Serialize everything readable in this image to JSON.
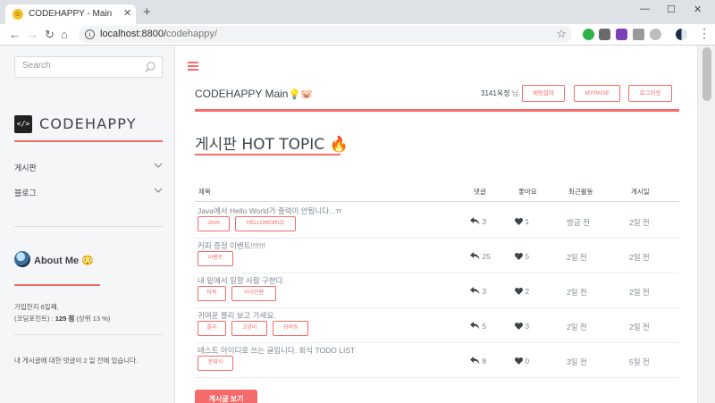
{
  "browser": {
    "tab_title": "CODEHAPPY - Main",
    "tab_favicon": "smiley-emoji",
    "url_host": "localhost:8800/",
    "url_path": "codehappy/",
    "colors": {
      "tabbar": "#dee1e6",
      "omnibox": "#f1f3f4"
    }
  },
  "sidebar": {
    "search_placeholder": "Search",
    "logo_icon_text": "</>",
    "logo_text": "CODEHAPPY",
    "menu": [
      {
        "label": "게시판"
      },
      {
        "label": "블로그"
      }
    ],
    "about_title": "About Me",
    "about_emoji": "😳",
    "join_text": "가입한지 6일째,",
    "points_prefix": "(코딩포인트) : ",
    "points_value": "125 점",
    "points_suffix": " (상위 13 %)",
    "notice": "내 게시글에 대한 댓글이 2 일 전에 있습니다."
  },
  "header": {
    "title": "CODEHAPPY Main",
    "title_emoji": "💡🐷",
    "user_name": "3141옥정",
    "user_suffix": " 님,",
    "buttons": [
      {
        "label": "채팅참여"
      },
      {
        "label": "MYPAGE"
      },
      {
        "label": "로그아웃"
      }
    ]
  },
  "section": {
    "title": "게시판 HOT TOPIC",
    "title_emoji": "🔥"
  },
  "table": {
    "columns": [
      "제목",
      "댓글",
      "좋아요",
      "최근활동",
      "게시일"
    ],
    "rows": [
      {
        "title": "Java에서 Hello World가 출력이 안됩니다...ㅠ",
        "tags": [
          "JAVA",
          "HELLOWORLD"
        ],
        "comments": "3",
        "likes": "1",
        "recent": "방금 전",
        "posted": "2일 전"
      },
      {
        "title": "커피 증정 이벤트!!!!!!!",
        "tags": [
          "이벤트"
        ],
        "comments": "25",
        "likes": "5",
        "recent": "2일 전",
        "posted": "2일 전"
      },
      {
        "title": "내 밑에서 일할 사람 구한다.",
        "tags": [
          "타북",
          "아이언맨"
        ],
        "comments": "3",
        "likes": "2",
        "recent": "2일 전",
        "posted": "2일 전"
      },
      {
        "title": "귀여운 쫄리 보고 가세요.",
        "tags": [
          "쫄리",
          "고양이",
          "귀여워"
        ],
        "comments": "5",
        "likes": "3",
        "recent": "2일 전",
        "posted": "2일 전"
      },
      {
        "title": "테스트 아이디로 쓰는 글입니다. 회식 TODO LIST",
        "tags": [
          "문화식"
        ],
        "comments": "8",
        "likes": "0",
        "recent": "3일 전",
        "posted": "5일 전"
      }
    ]
  },
  "write_button": "게시글 보기",
  "theme": {
    "accent": "#f56a6a",
    "text": "#3d4449",
    "muted": "#7f888f",
    "sidebar_bg": "#f5f6f7"
  }
}
